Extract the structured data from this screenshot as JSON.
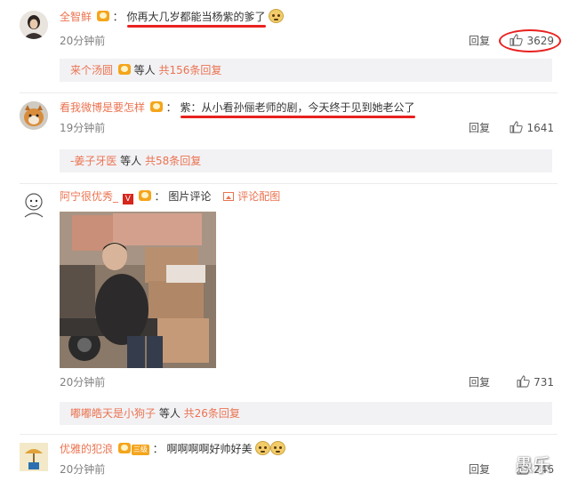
{
  "comments": [
    {
      "user": "全智鲜",
      "colon": "：",
      "text": "你再大几岁都能当杨紫的爹了",
      "time": "20分钟前",
      "reply_label": "回复",
      "likes": "3629",
      "sub": {
        "name": "来个汤圆",
        "mid": " 等人 ",
        "count": "共156条回复"
      }
    },
    {
      "user": "看我微博是要怎样",
      "colon": "：",
      "text": "紫：从小看孙俪老师的剧，今天终于见到她老公了",
      "time": "19分钟前",
      "reply_label": "回复",
      "likes": "1641",
      "sub": {
        "name": "-姜子牙医",
        "mid": " 等人 ",
        "count": "共58条回复"
      }
    },
    {
      "user": "阿宁很优秀_",
      "colon": "：",
      "text": "图片评论",
      "pic_link": "评论配图",
      "time": "20分钟前",
      "reply_label": "回复",
      "likes": "731",
      "sub": {
        "name": "嘟嘟皓天是小狗子",
        "mid": " 等人 ",
        "count": "共26条回复"
      }
    },
    {
      "user": "优雅的犯浪",
      "colon": "：",
      "level_badge": "三级",
      "text": "啊啊啊啊好帅好美",
      "time": "20分钟前",
      "reply_label": "回复",
      "likes": "246"
    }
  ],
  "red_badge": "V",
  "watermark": "愚乐"
}
